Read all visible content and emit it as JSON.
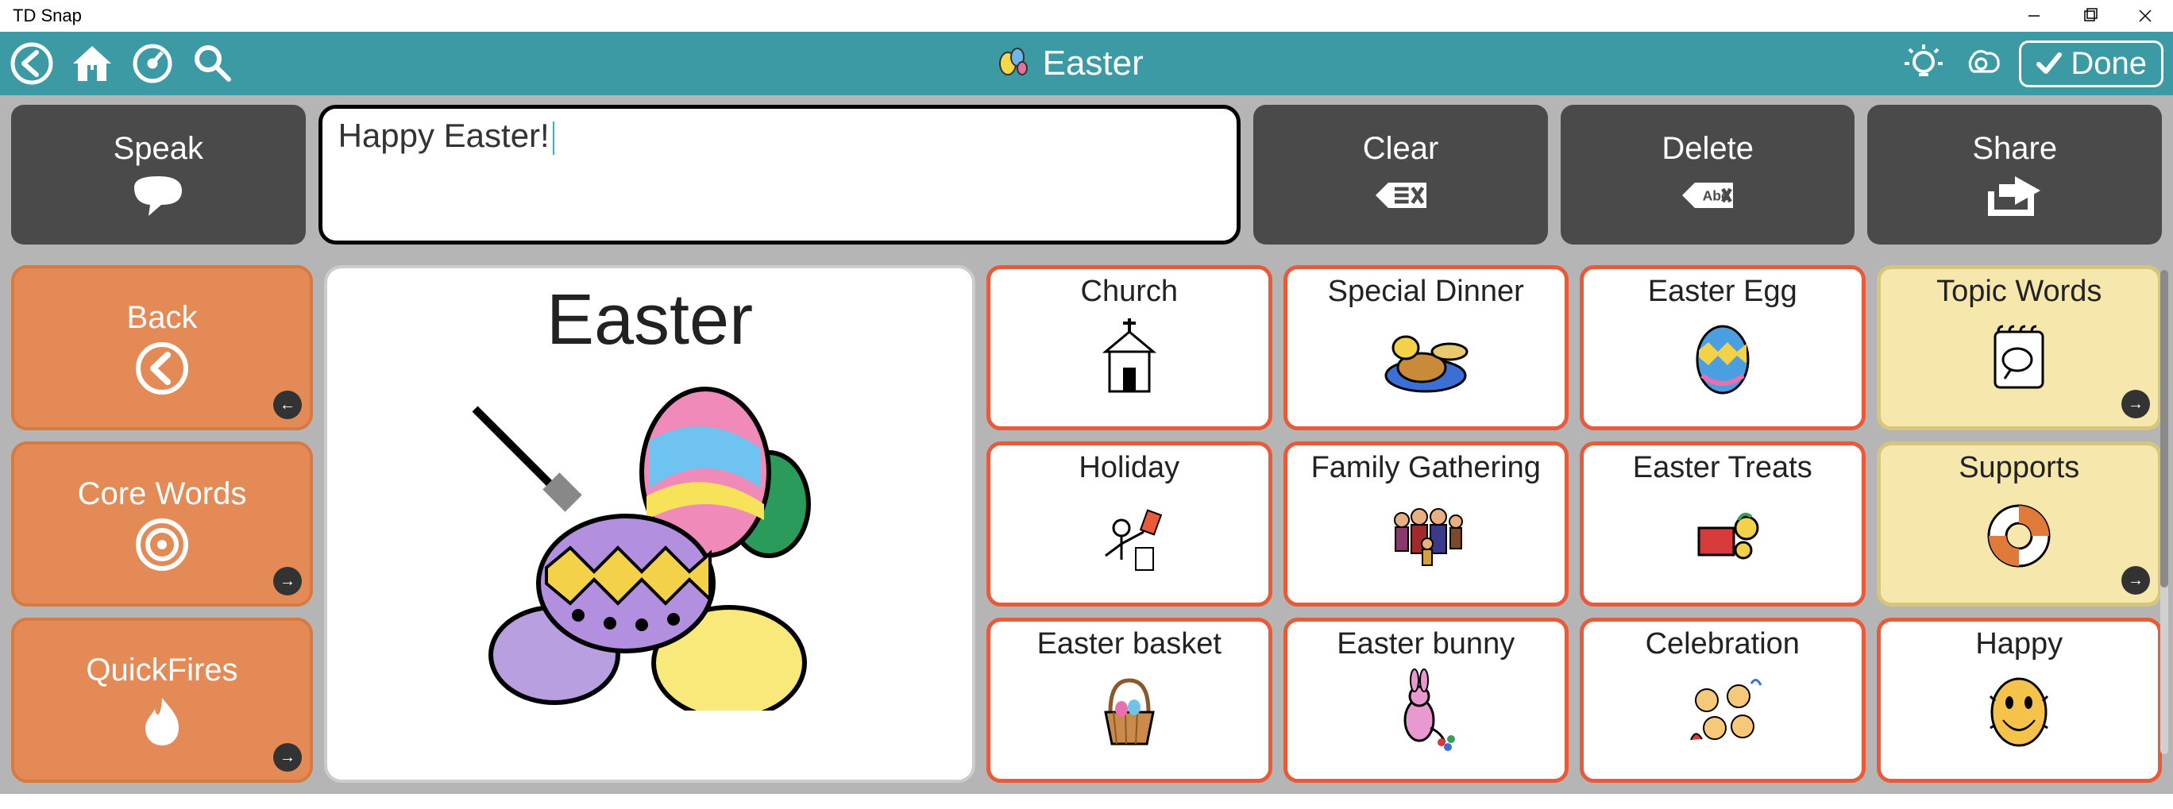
{
  "window": {
    "title": "TD Snap"
  },
  "toolbar": {
    "page_title": "Easter",
    "done_label": "Done"
  },
  "message_bar": {
    "speak": "Speak",
    "text": "Happy Easter!",
    "clear": "Clear",
    "delete": "Delete",
    "share": "Share"
  },
  "sidebar": {
    "back": "Back",
    "core": "Core Words",
    "quick": "QuickFires"
  },
  "hero": {
    "title": "Easter"
  },
  "cells": {
    "row1": [
      "Church",
      "Special Dinner",
      "Easter Egg",
      "Topic Words"
    ],
    "row2": [
      "Holiday",
      "Family Gathering",
      "Easter Treats",
      "Supports"
    ],
    "row3": [
      "Easter basket",
      "Easter bunny",
      "Celebration",
      "Happy"
    ]
  }
}
